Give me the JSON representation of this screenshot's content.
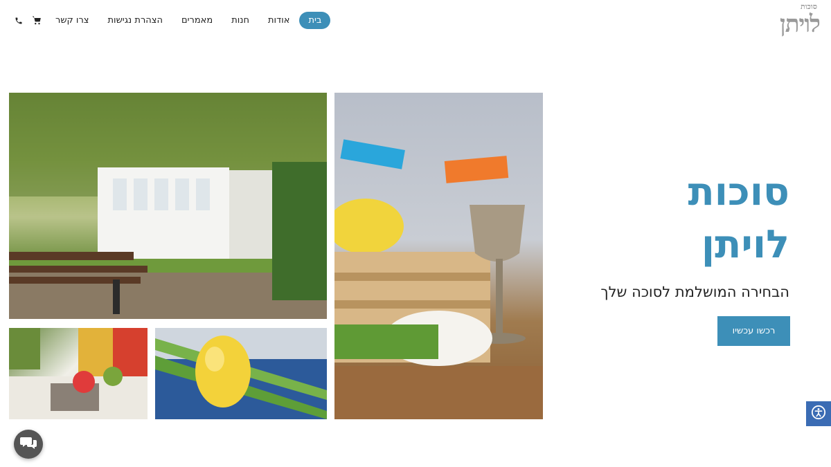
{
  "header": {
    "logo": {
      "small": "סוכות",
      "big": "לויתן"
    },
    "nav": [
      {
        "label": "בית",
        "active": true
      },
      {
        "label": "אודות"
      },
      {
        "label": "חנות"
      },
      {
        "label": "מאמרים"
      },
      {
        "label": "הצהרת נגישות"
      },
      {
        "label": "צרו קשר"
      }
    ],
    "icons": [
      "cart-icon",
      "phone-icon"
    ]
  },
  "hero": {
    "title_line1": "סוכות",
    "title_line2": "לויתן",
    "subtitle": "הבחירה המושלמת לסוכה שלך",
    "cta_label": "רכשו עכשיו"
  },
  "colors": {
    "accent": "#3d8fb8",
    "access_button": "#3b6cb4",
    "chat": "#555555"
  }
}
